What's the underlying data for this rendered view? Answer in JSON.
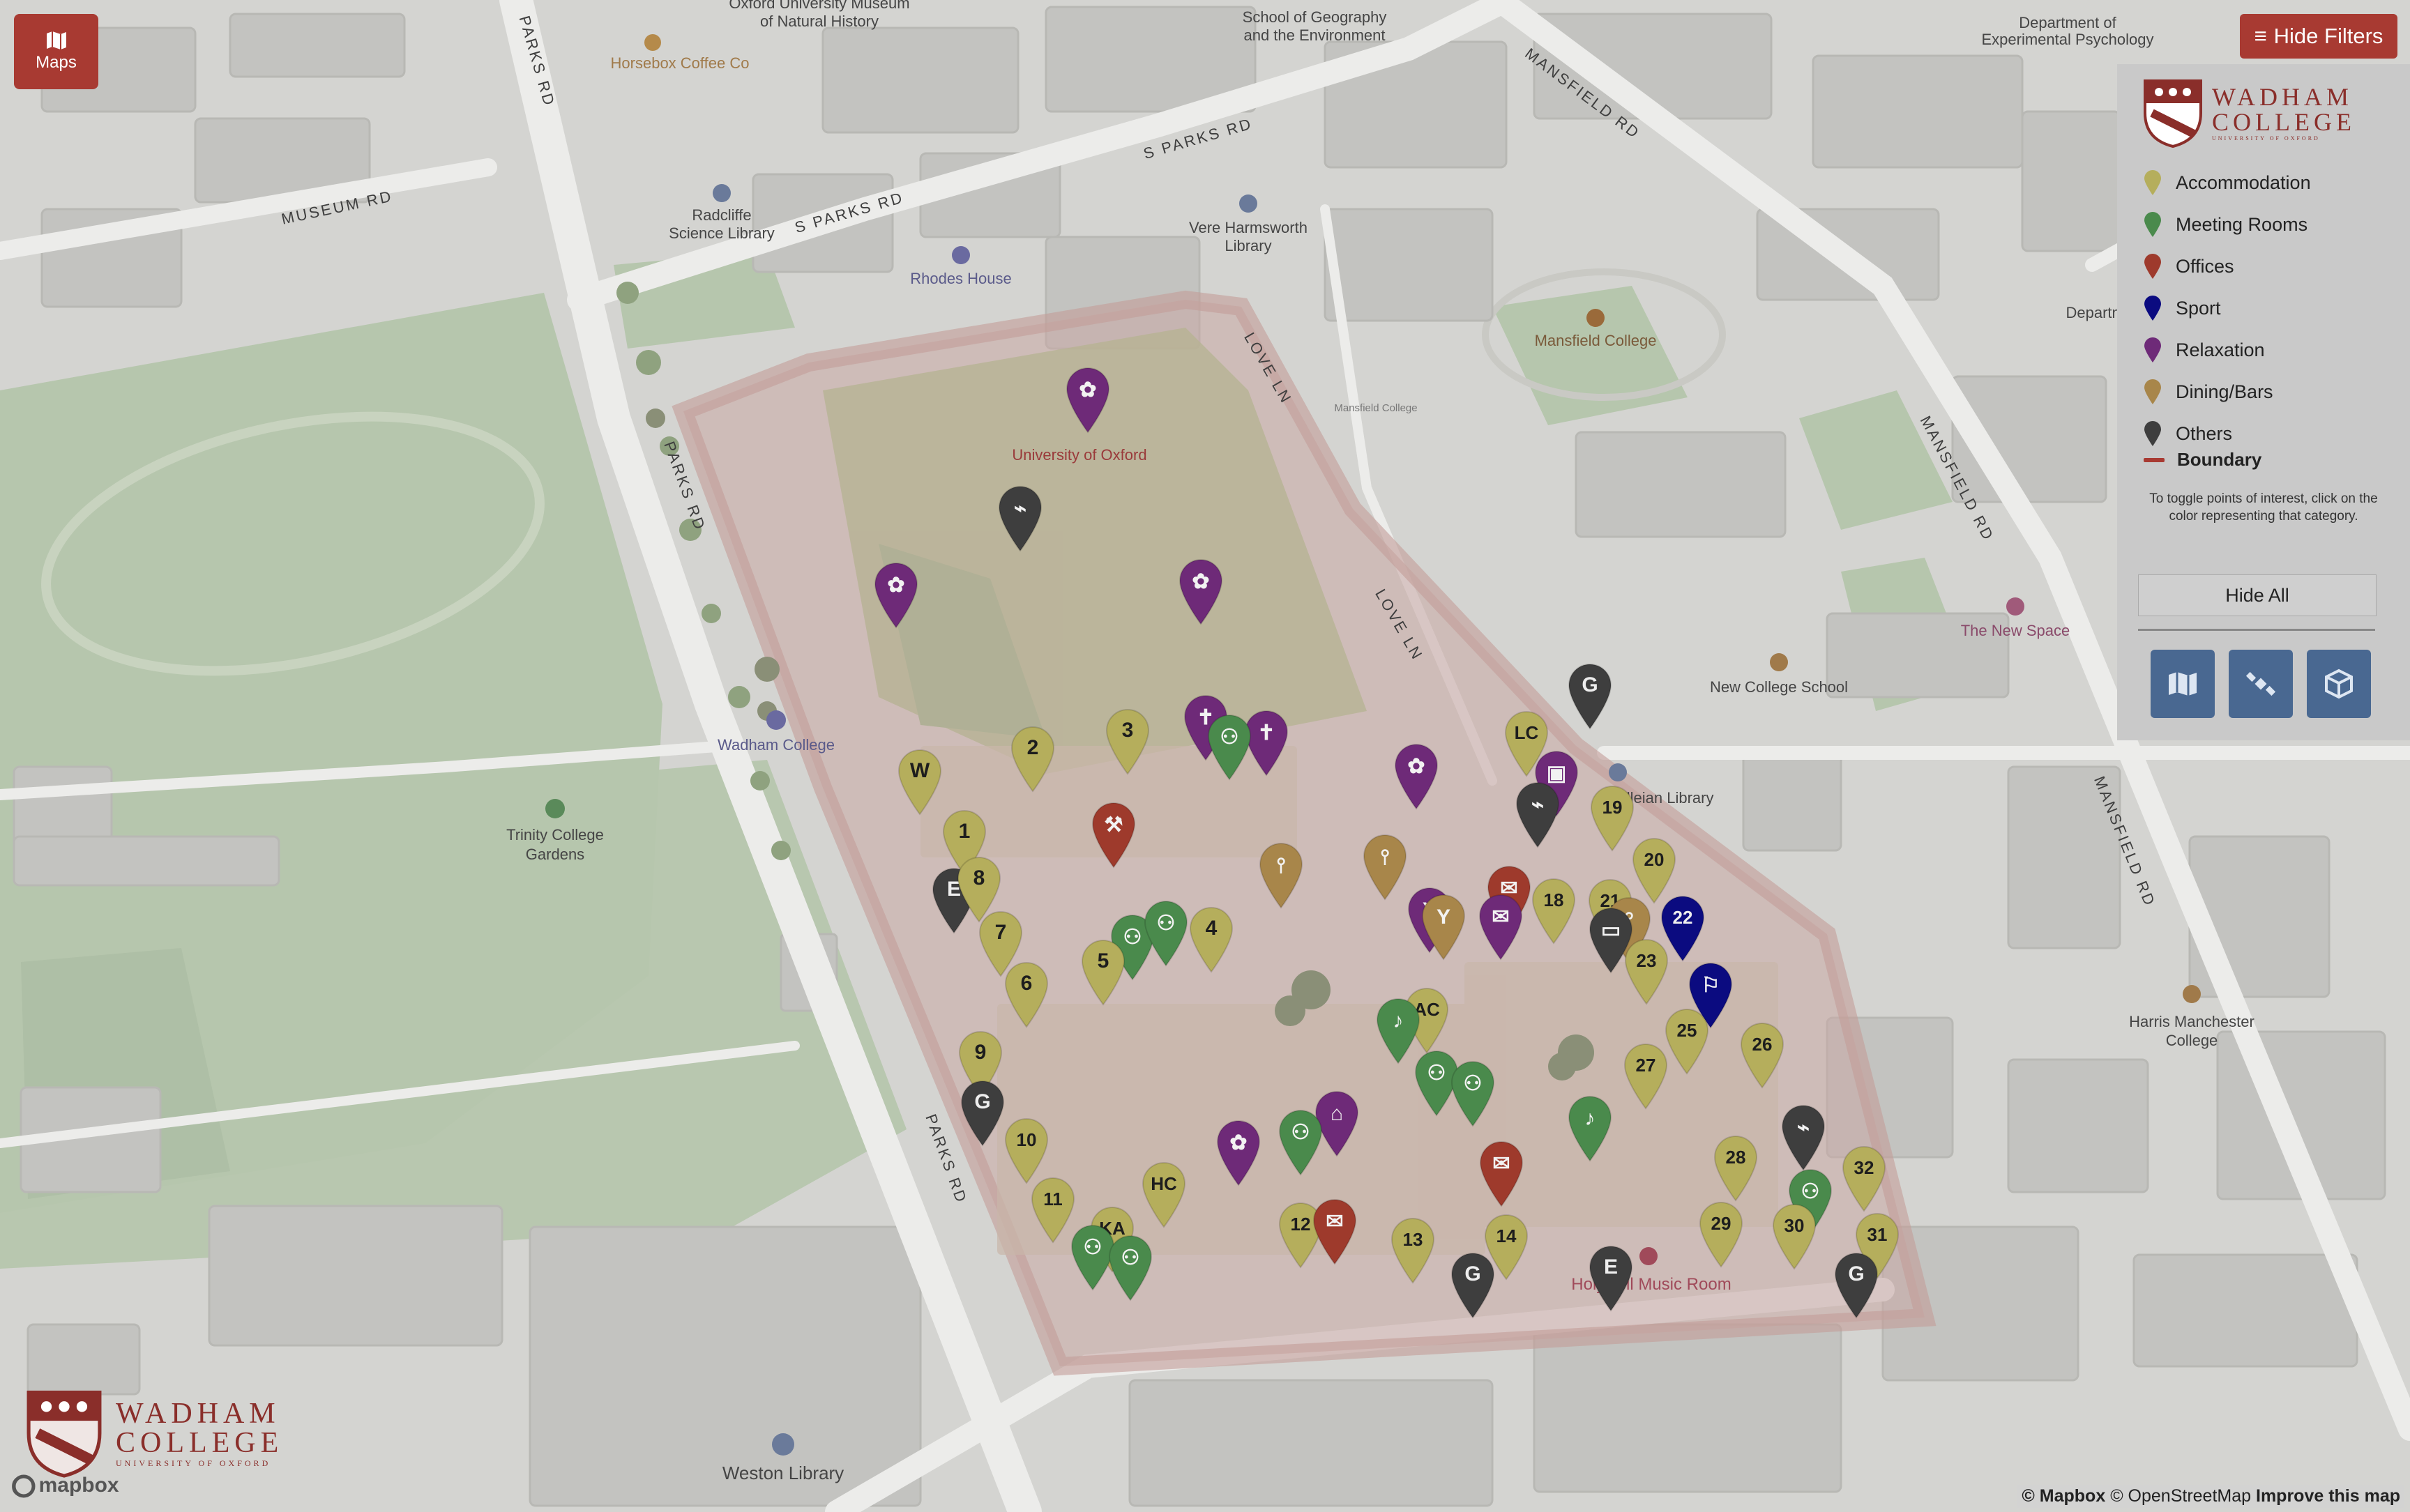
{
  "app": {
    "maps_label": "Maps",
    "hide_filters_label": "Hide Filters"
  },
  "logo": {
    "line1": "WADHAM",
    "line2": "COLLEGE",
    "line3": "UNIVERSITY OF OXFORD"
  },
  "categories": [
    {
      "label": "Accommodation",
      "color": "#b5ae5c"
    },
    {
      "label": "Meeting Rooms",
      "color": "#4a8a4c"
    },
    {
      "label": "Offices",
      "color": "#9e3a2c"
    },
    {
      "label": "Sport",
      "color": "#0b0b80"
    },
    {
      "label": "Relaxation",
      "color": "#6e2a78"
    },
    {
      "label": "Dining/Bars",
      "color": "#a8864a"
    },
    {
      "label": "Others",
      "color": "#3e3e3e"
    }
  ],
  "boundary_label": "Boundary",
  "help_text": "To toggle points of interest, click on the color representing that category.",
  "hide_all_label": "Hide All",
  "view_buttons": [
    {
      "icon": "map-icon"
    },
    {
      "icon": "satellite-icon"
    },
    {
      "icon": "cube-icon"
    }
  ],
  "attribution": {
    "mapbox": "© Mapbox",
    "osm": "© OpenStreetMap",
    "improve": "Improve this map"
  },
  "watermark": "mapbox",
  "street_labels": [
    "MUSEUM RD",
    "S PARKS RD",
    "S PARKS RD",
    "PARKS RD",
    "PARKS RD",
    "PARKS RD",
    "LOVE LN",
    "LOVE LN",
    "MANSFIELD RD",
    "MANSFIELD RD",
    "MANSFIELD RD"
  ],
  "place_labels": [
    "Horsebox Coffee Co",
    "Oxford University Museum",
    "of Natural History",
    "School of Geography",
    "and the Environment",
    "Department of",
    "Experimental Psychology",
    "Radcliffe",
    "Science Library",
    "Rhodes House",
    "Vere Harmsworth",
    "Library",
    "Mansfield College",
    "University of Oxford",
    "Wadham College",
    "Trinity College",
    "Gardens",
    "New College School",
    "The New Space",
    "Harris Manchester",
    "College",
    "Holywell Music Room",
    "Weston Library",
    "Bodleian Library",
    "Department",
    "Mansfield College"
  ],
  "markers": [
    {
      "label": "",
      "cat": "Relaxation",
      "icon": "flower"
    },
    {
      "label": "",
      "cat": "Others",
      "icon": "smoking"
    },
    {
      "label": "",
      "cat": "Relaxation",
      "icon": "flower"
    },
    {
      "label": "",
      "cat": "Relaxation",
      "icon": "flower"
    },
    {
      "label": "3",
      "cat": "Accommodation"
    },
    {
      "label": "2",
      "cat": "Accommodation"
    },
    {
      "label": "W",
      "cat": "Accommodation"
    },
    {
      "label": "",
      "cat": "Relaxation",
      "icon": "cross"
    },
    {
      "label": "",
      "cat": "Relaxation",
      "icon": "cross"
    },
    {
      "label": "",
      "cat": "Meeting Rooms",
      "icon": "people"
    },
    {
      "label": "",
      "cat": "Relaxation",
      "icon": "flower"
    },
    {
      "label": "G",
      "cat": "Others"
    },
    {
      "label": "LC",
      "cat": "Accommodation"
    },
    {
      "label": "",
      "cat": "Relaxation",
      "icon": "book"
    },
    {
      "label": "",
      "cat": "Others",
      "icon": "smoking"
    },
    {
      "label": "19",
      "cat": "Accommodation"
    },
    {
      "label": "20",
      "cat": "Accommodation"
    },
    {
      "label": "1",
      "cat": "Accommodation"
    },
    {
      "label": "E",
      "cat": "Others"
    },
    {
      "label": "8",
      "cat": "Accommodation"
    },
    {
      "label": "",
      "cat": "Offices",
      "icon": "tools"
    },
    {
      "label": "",
      "cat": "Dining/Bars",
      "icon": "fork"
    },
    {
      "label": "",
      "cat": "Dining/Bars",
      "icon": "fork"
    },
    {
      "label": "7",
      "cat": "Accommodation"
    },
    {
      "label": "",
      "cat": "Meeting Rooms",
      "icon": "people"
    },
    {
      "label": "",
      "cat": "Meeting Rooms",
      "icon": "people"
    },
    {
      "label": "4",
      "cat": "Accommodation"
    },
    {
      "label": "5",
      "cat": "Accommodation"
    },
    {
      "label": "6",
      "cat": "Accommodation"
    },
    {
      "label": "",
      "cat": "Relaxation",
      "icon": "cocktail"
    },
    {
      "label": "",
      "cat": "Dining/Bars",
      "icon": "cocktail"
    },
    {
      "label": "",
      "cat": "Offices",
      "icon": "mail"
    },
    {
      "label": "",
      "cat": "Relaxation",
      "icon": "mail"
    },
    {
      "label": "18",
      "cat": "Accommodation"
    },
    {
      "label": "21",
      "cat": "Accommodation"
    },
    {
      "label": "",
      "cat": "Dining/Bars",
      "icon": "fork"
    },
    {
      "label": "22",
      "cat": "Sport",
      "icon": "dumbbell"
    },
    {
      "label": "23",
      "cat": "Accommodation"
    },
    {
      "label": "",
      "cat": "Others",
      "icon": "laptop"
    },
    {
      "label": "",
      "cat": "Sport",
      "icon": "runner"
    },
    {
      "label": "AC",
      "cat": "Accommodation"
    },
    {
      "label": "25",
      "cat": "Accommodation"
    },
    {
      "label": "26",
      "cat": "Accommodation"
    },
    {
      "label": "27",
      "cat": "Accommodation"
    },
    {
      "label": "9",
      "cat": "Accommodation"
    },
    {
      "label": "G",
      "cat": "Others"
    },
    {
      "label": "10",
      "cat": "Accommodation"
    },
    {
      "label": "",
      "cat": "Meeting Rooms",
      "icon": "music"
    },
    {
      "label": "",
      "cat": "Meeting Rooms",
      "icon": "people"
    },
    {
      "label": "",
      "cat": "Meeting Rooms",
      "icon": "people"
    },
    {
      "label": "",
      "cat": "Relaxation",
      "icon": "flower"
    },
    {
      "label": "",
      "cat": "Relaxation",
      "icon": "sofa"
    },
    {
      "label": "",
      "cat": "Meeting Rooms",
      "icon": "people"
    },
    {
      "label": "",
      "cat": "Meeting Rooms",
      "icon": "music"
    },
    {
      "label": "",
      "cat": "Others",
      "icon": "smoking"
    },
    {
      "label": "28",
      "cat": "Accommodation"
    },
    {
      "label": "32",
      "cat": "Accommodation"
    },
    {
      "label": "",
      "cat": "Offices",
      "icon": "mail"
    },
    {
      "label": "11",
      "cat": "Accommodation"
    },
    {
      "label": "HC",
      "cat": "Accommodation"
    },
    {
      "label": "KA",
      "cat": "Accommodation"
    },
    {
      "label": "",
      "cat": "Meeting Rooms",
      "icon": "people"
    },
    {
      "label": "",
      "cat": "Meeting Rooms",
      "icon": "people"
    },
    {
      "label": "12",
      "cat": "Accommodation"
    },
    {
      "label": "",
      "cat": "Offices",
      "icon": "mail"
    },
    {
      "label": "13",
      "cat": "Accommodation"
    },
    {
      "label": "14",
      "cat": "Accommodation"
    },
    {
      "label": "G",
      "cat": "Others"
    },
    {
      "label": "E",
      "cat": "Others"
    },
    {
      "label": "",
      "cat": "Meeting Rooms",
      "icon": "people"
    },
    {
      "label": "29",
      "cat": "Accommodation"
    },
    {
      "label": "30",
      "cat": "Accommodation"
    },
    {
      "label": "31",
      "cat": "Accommodation"
    },
    {
      "label": "G",
      "cat": "Others"
    }
  ]
}
